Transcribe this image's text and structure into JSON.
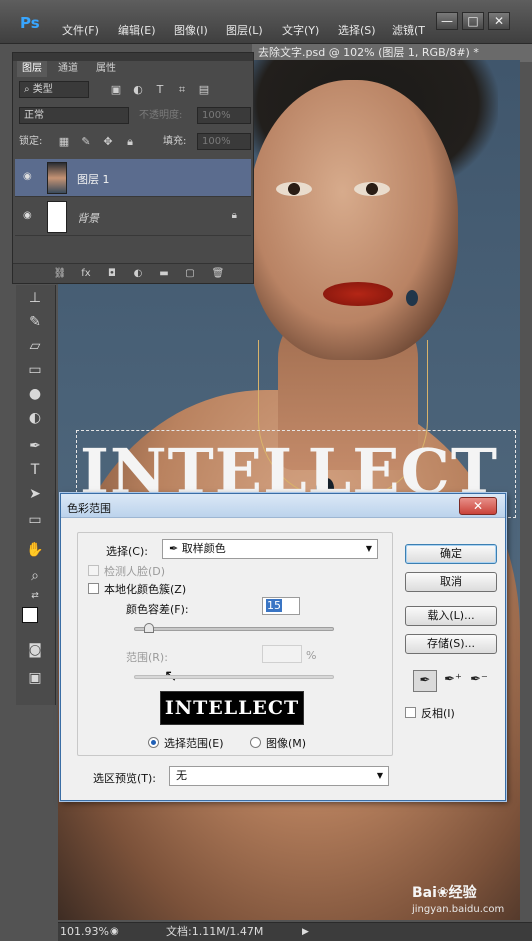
{
  "app": {
    "logo": "Ps"
  },
  "menu": [
    "文件(F)",
    "编辑(E)",
    "图像(I)",
    "图层(L)",
    "文字(Y)",
    "选择(S)",
    "滤镜(T"
  ],
  "window_controls": {
    "minimize": "—",
    "restore": "□",
    "close": "✕"
  },
  "document": {
    "tab_title": "去除文字.psd @ 102% (图层 1, RGB/8#) *",
    "canvas_text": "INTELLECT"
  },
  "layers_panel": {
    "tabs": [
      "图层",
      "通道",
      "属性"
    ],
    "filter_kind": "类型",
    "blend_mode": "正常",
    "opacity_label": "不透明度:",
    "opacity_value": "100%",
    "lock_label": "锁定:",
    "fill_label": "填充:",
    "fill_value": "100%",
    "layers": [
      {
        "name": "图层 1",
        "selected": true
      },
      {
        "name": "背景",
        "locked": true
      }
    ],
    "footer_icons": [
      "link-icon",
      "fx-icon",
      "mask-icon",
      "adjustment-icon",
      "folder-icon",
      "new-layer-icon",
      "trash-icon"
    ]
  },
  "status_bar": {
    "zoom": "101.93%",
    "doc_info": "文档:1.11M/1.47M"
  },
  "color_range_dialog": {
    "title": "色彩范围",
    "select_label": "选择(C):",
    "select_value": "取样颜色",
    "detect_faces": "检测人脸(D)",
    "localized_clusters": "本地化颜色簇(Z)",
    "fuzziness_label": "颜色容差(F):",
    "fuzziness_value": "15",
    "range_label": "范围(R):",
    "range_unit": "%",
    "preview_text": "INTELLECT",
    "radio_selection": "选择范围(E)",
    "radio_image": "图像(M)",
    "selection_preview_label": "选区预览(T):",
    "selection_preview_value": "无",
    "buttons": {
      "ok": "确定",
      "cancel": "取消",
      "load": "载入(L)...",
      "save": "存储(S)..."
    },
    "invert": "反相(I)"
  },
  "watermark": {
    "brand": "Bai❀经验",
    "url": "jingyan.baidu.com"
  }
}
